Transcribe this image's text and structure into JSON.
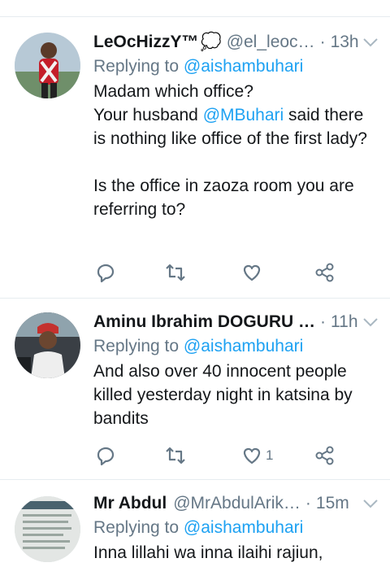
{
  "tweets": [
    {
      "name": "LeOcHizzY™",
      "handle": "@el_leoc…",
      "separator": "·",
      "time": "13h",
      "replying_prefix": "Replying to",
      "replying_to": "@aishambuhari",
      "body_part1": "Madam which office?\nYour husband ",
      "body_mention": "@MBuhari",
      "body_part2": " said there is nothing like office of the first lady?\n\nIs the office in zaoza room you are referring to?",
      "like_count": ""
    },
    {
      "name": "Aminu Ibrahim DOGURU …",
      "separator": "·",
      "time": "11h",
      "replying_prefix": "Replying to",
      "replying_to": "@aishambuhari",
      "body": "And also over 40 innocent people killed yesterday night in katsina by bandits",
      "like_count": "1"
    },
    {
      "name": "Mr Abdul",
      "handle": "@MrAbdulArik…",
      "separator": "·",
      "time": "15m",
      "replying_prefix": "Replying to",
      "replying_to": "@aishambuhari",
      "body": "Inna lillahi wa inna ilaihi rajiun,"
    }
  ],
  "icons": {
    "reply": "reply-icon",
    "retweet": "retweet-icon",
    "like": "heart-icon",
    "share": "share-icon",
    "caret": "chevron-down-icon"
  },
  "colors": {
    "link": "#1da1f2",
    "secondary_text": "#657786",
    "divider": "#e6ecf0"
  }
}
